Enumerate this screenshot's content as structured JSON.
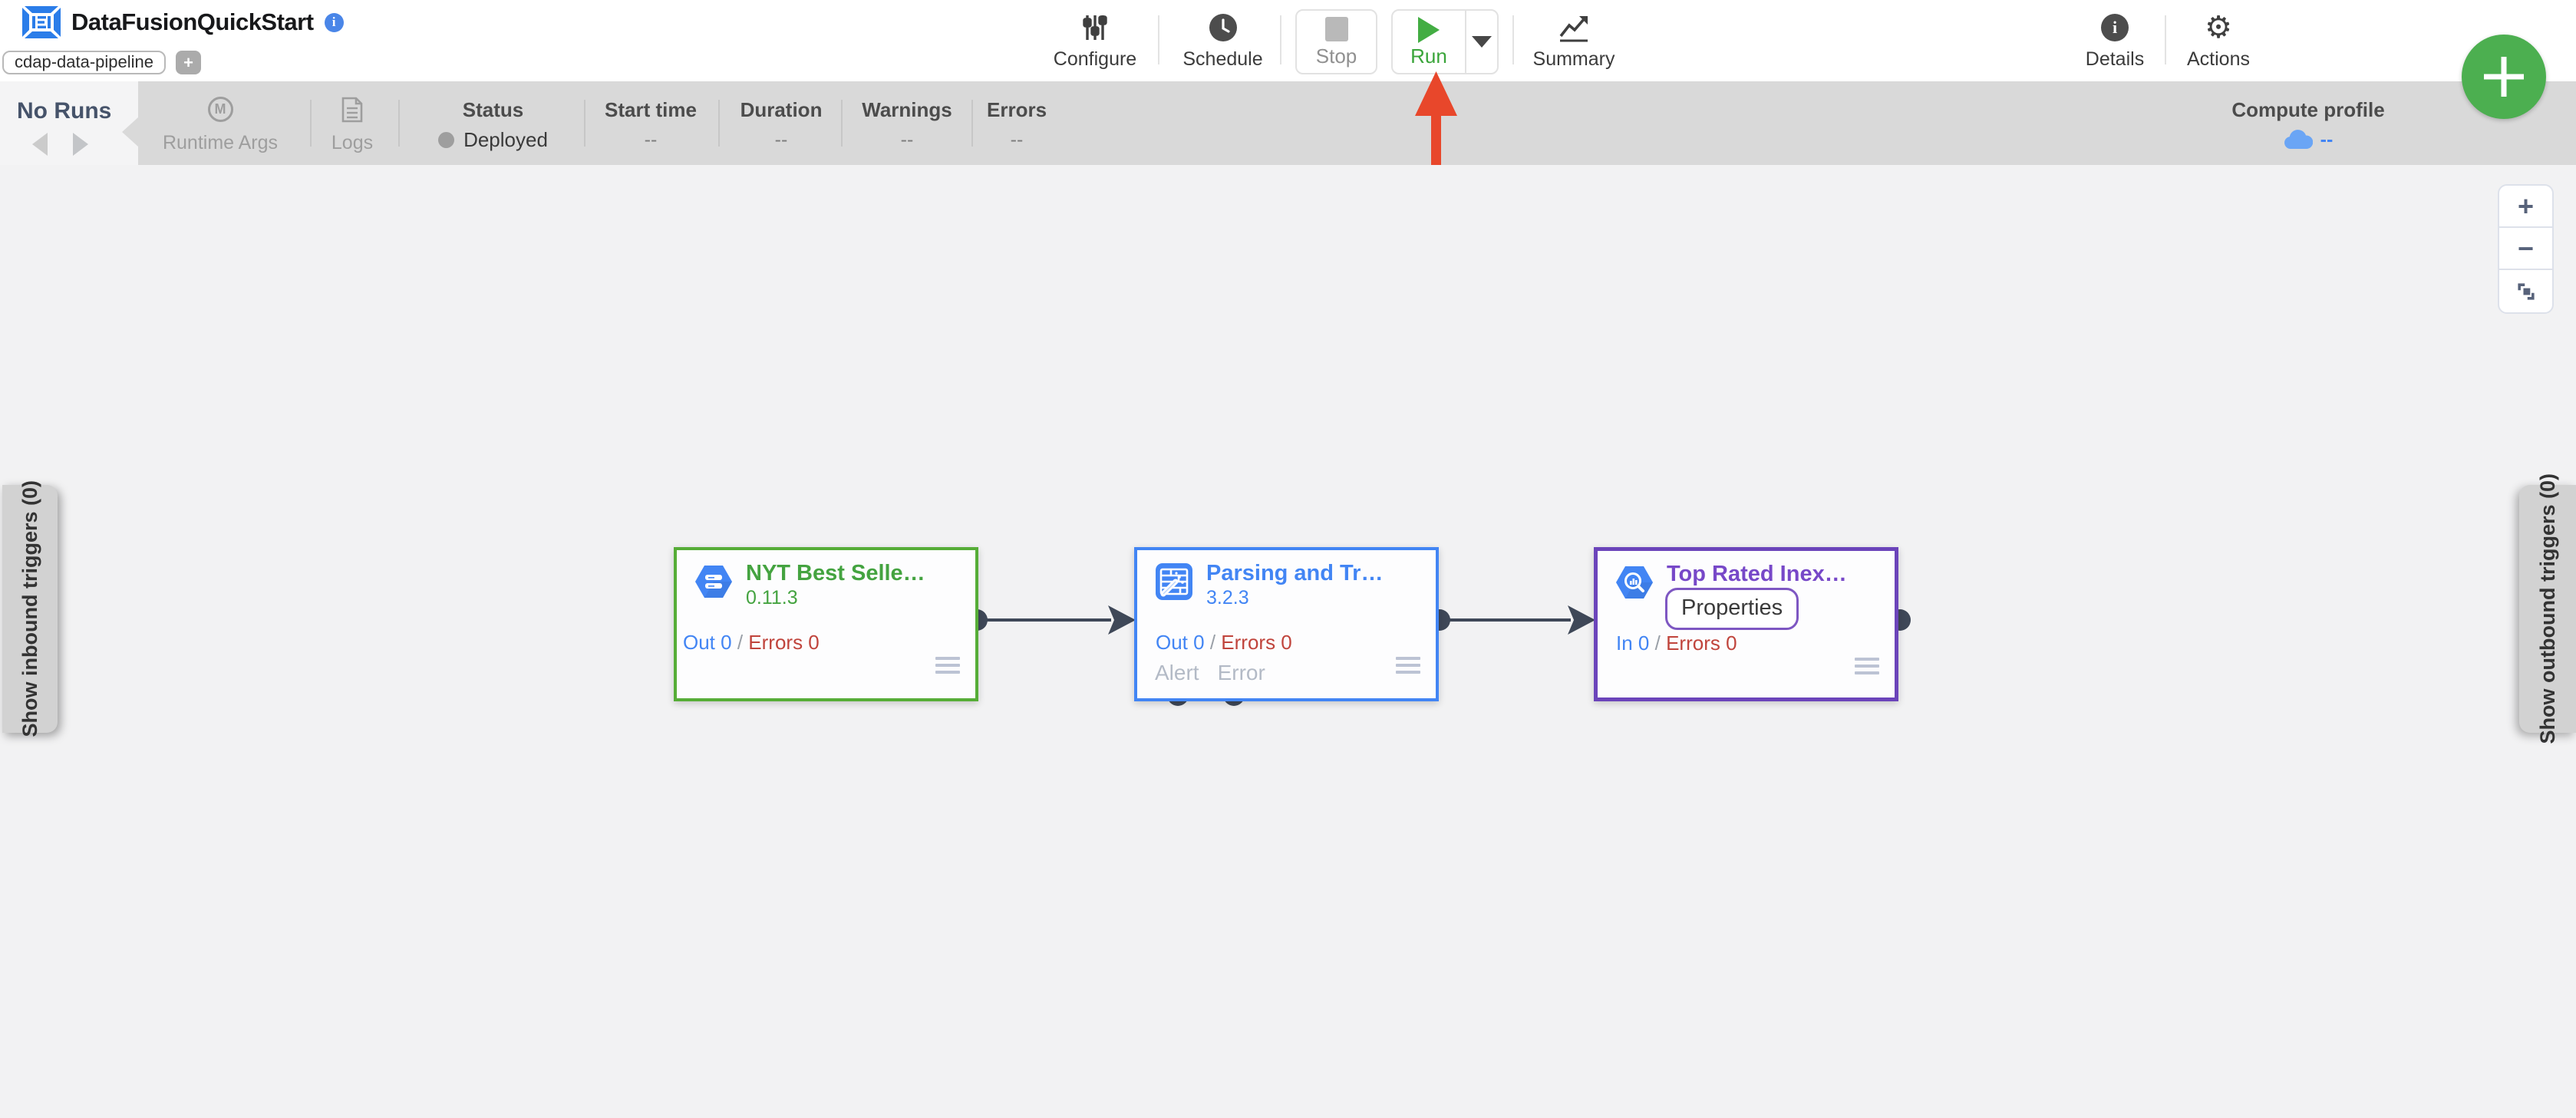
{
  "header": {
    "app_title": "DataFusionQuickStart",
    "pipeline_type_badge": "cdap-data-pipeline",
    "add_badge_label": "+",
    "icons": {
      "info_glyph": "i",
      "details_glyph": "i",
      "actions_glyph": "⚙",
      "runtime_args_glyph": "M"
    },
    "toolbar": {
      "configure_label": "Configure",
      "schedule_label": "Schedule",
      "stop_label": "Stop",
      "run_label": "Run",
      "summary_label": "Summary",
      "details_label": "Details",
      "actions_label": "Actions"
    }
  },
  "runbar": {
    "no_runs_label": "No Runs",
    "runtime_args_label": "Runtime Args",
    "logs_label": "Logs",
    "status": {
      "label": "Status",
      "value": "Deployed"
    },
    "columns": [
      {
        "label": "Start time",
        "value": "--"
      },
      {
        "label": "Duration",
        "value": "--"
      },
      {
        "label": "Warnings",
        "value": "--"
      },
      {
        "label": "Errors",
        "value": "--"
      }
    ],
    "compute_profile": {
      "label": "Compute profile",
      "value": "--"
    }
  },
  "canvas": {
    "inbound_triggers_tab": "Show inbound triggers (0)",
    "outbound_triggers_tab": "Show outbound triggers (0)",
    "zoom_in_label": "+",
    "zoom_out_label": "−",
    "nodes": [
      {
        "title": "NYT Best Selle…",
        "version": "0.11.3",
        "metric_primary": "Out 0",
        "metric_separator": "/",
        "metric_errors": "Errors 0"
      },
      {
        "title": "Parsing and Tr…",
        "version": "3.2.3",
        "metric_primary": "Out 0",
        "metric_separator": "/",
        "metric_errors": "Errors 0",
        "port_labels": [
          "Alert",
          "Error"
        ]
      },
      {
        "title": "Top Rated Inex…",
        "properties_button": "Properties",
        "metric_primary": "In 0",
        "metric_separator": "/",
        "metric_errors": "Errors 0"
      }
    ]
  },
  "colors": {
    "header_bg": "#ffffff",
    "runbar_bg": "#d9d9d9",
    "canvas_bg": "#f2f2f3",
    "accent_green": "#4caf50",
    "accent_blue": "#4285f4",
    "error_red": "#c0443c",
    "node_green_border": "#56ad37",
    "node_blue_border": "#4285f4",
    "node_purple_border": "#6b44ba",
    "port_slate": "#3f4858",
    "annotation_arrow_red": "#e8472b",
    "disabled_gray": "#9e9e9e"
  }
}
